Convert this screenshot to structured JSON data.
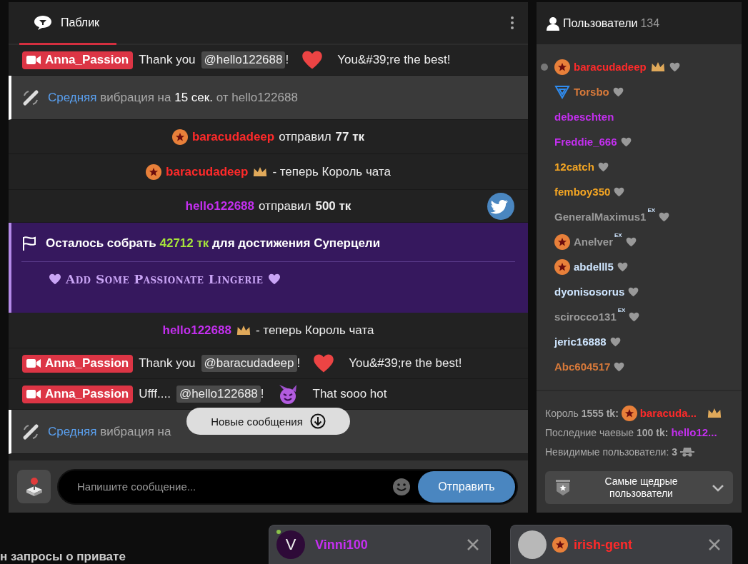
{
  "chat": {
    "tab": {
      "label": "Паблик",
      "selected": true
    },
    "messages": [
      {
        "kind": "model",
        "name": "Anna_Passion",
        "parts": [
          {
            "kind": "text",
            "text": "Thank you"
          },
          {
            "kind": "mention",
            "text": "@hello122688"
          },
          {
            "kind": "text",
            "text": "!"
          },
          {
            "kind": "heart"
          },
          {
            "kind": "text",
            "text": "You&#39;re the best!"
          }
        ]
      },
      {
        "kind": "vibe",
        "level_word": "Средняя",
        "text": "вибрация на",
        "duration": "15 сек.",
        "from": "от hello122688"
      },
      {
        "kind": "tip",
        "user": "baracudadeep",
        "color": "#ff2a2a",
        "star": true,
        "verb": "отправил",
        "amount": "77 тк"
      },
      {
        "kind": "king",
        "user": "baracudadeep",
        "color": "#ff2a2a",
        "star": true,
        "text": "- теперь Король чата"
      },
      {
        "kind": "tip",
        "user": "hello122688",
        "color": "#c42ff0",
        "star": false,
        "verb": "отправил",
        "amount": "500 тк"
      },
      {
        "kind": "goal",
        "before": "Осталось собрать",
        "amount": "42712 тк",
        "after": "для достижения Суперцели",
        "title": "Add Some Passionate Lingerie"
      },
      {
        "kind": "king",
        "user": "hello122688",
        "color": "#c42ff0",
        "star": false,
        "text": "- теперь Король чата"
      },
      {
        "kind": "model",
        "name": "Anna_Passion",
        "parts": [
          {
            "kind": "text",
            "text": "Thank you"
          },
          {
            "kind": "mention",
            "text": "@baracudadeep"
          },
          {
            "kind": "text",
            "text": "!"
          },
          {
            "kind": "heart"
          },
          {
            "kind": "text",
            "text": "You&#39;re the best!"
          }
        ]
      },
      {
        "kind": "model",
        "name": "Anna_Passion",
        "parts": [
          {
            "kind": "text",
            "text": "Ufff...."
          },
          {
            "kind": "mention",
            "text": "@hello122688"
          },
          {
            "kind": "text",
            "text": "!"
          },
          {
            "kind": "devil"
          },
          {
            "kind": "text",
            "text": "That sooo hot"
          }
        ]
      },
      {
        "kind": "vibe",
        "level_word": "Средняя",
        "text": "вибрация на"
      }
    ],
    "new_messages_button": "Новые сообщения",
    "input": {
      "placeholder": "Напишите сообщение..."
    },
    "send_button": "Отправить"
  },
  "users": {
    "title": "Пользователи",
    "count": "134",
    "items": [
      {
        "kind": "star",
        "name": "baracudadeep",
        "color": "#ff2a2a",
        "online": true,
        "crown": true,
        "heart": true
      },
      {
        "kind": "triangle",
        "name": "Torsbo",
        "color": "#d97a3a",
        "online": false,
        "crown": false,
        "heart": true
      },
      {
        "kind": "plain",
        "name": "debeschten",
        "color": "#c42ff0",
        "online": false,
        "crown": false,
        "heart": false
      },
      {
        "kind": "plain",
        "name": "Freddie_666",
        "color": "#c42ff0",
        "online": false,
        "crown": false,
        "heart": true
      },
      {
        "kind": "plain",
        "name": "12catch",
        "color": "#f5a623",
        "online": false,
        "crown": false,
        "heart": true
      },
      {
        "kind": "plain",
        "name": "femboy350",
        "color": "#f5a623",
        "online": false,
        "crown": false,
        "heart": true
      },
      {
        "kind": "plain",
        "name": "GeneralMaximus1",
        "color": "#9a9a9a",
        "online": false,
        "crown": false,
        "heart": true,
        "ex": "EX"
      },
      {
        "kind": "star",
        "name": "Anelver",
        "color": "#9a9a9a",
        "online": false,
        "crown": false,
        "heart": true,
        "ex": "EX"
      },
      {
        "kind": "star",
        "name": "abdelll5",
        "color": "#cfe6ff",
        "online": false,
        "crown": false,
        "heart": true
      },
      {
        "kind": "plain",
        "name": "dyonisosorus",
        "color": "#cfe6ff",
        "online": false,
        "crown": false,
        "heart": true
      },
      {
        "kind": "plain",
        "name": "scirocco131",
        "color": "#9a9a9a",
        "online": false,
        "crown": false,
        "heart": true,
        "ex": "EX"
      },
      {
        "kind": "plain",
        "name": "jeric16888",
        "color": "#cfe6ff",
        "online": false,
        "crown": false,
        "heart": true
      },
      {
        "kind": "plain",
        "name": "Abc604517",
        "color": "#d97a3a",
        "online": false,
        "crown": false,
        "heart": true
      }
    ],
    "king": {
      "label": "Король",
      "amount": "1555 tk:",
      "user": "baracuda...",
      "color": "#ff2a2a",
      "star": true
    },
    "last_tip": {
      "label": "Последние чаевые",
      "amount": "100 tk:",
      "user": "hello12...",
      "color": "#c42ff0"
    },
    "invisible": {
      "label": "Невидимые пользователи:",
      "count": "3"
    },
    "top_button": {
      "label": "Самые щедрые пользователи",
      "expanded": false
    }
  },
  "privates": {
    "requests_text": "н запросы о привате",
    "chats": [
      {
        "kind": "letter",
        "name": "Vinni100",
        "color": "#c42ff0",
        "letter": "V",
        "online": true,
        "star": false
      },
      {
        "kind": "photo",
        "name": "irish-gent",
        "color": "#ff2a2a",
        "online": false,
        "star": true
      }
    ]
  }
}
